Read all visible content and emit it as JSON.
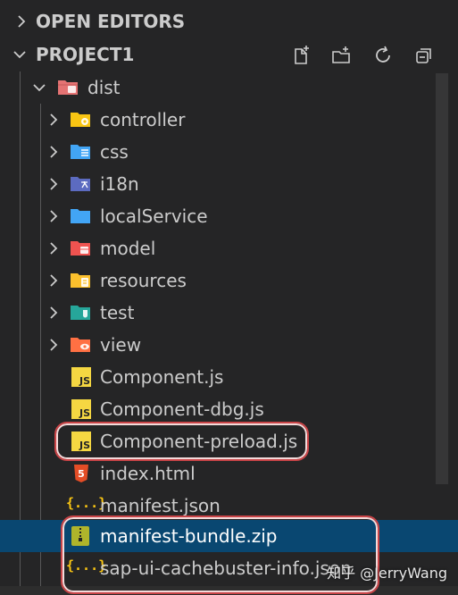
{
  "sections": {
    "open_editors": "OPEN EDITORS",
    "project": "PROJECT1"
  },
  "toolbar": {
    "new_file": "new-file-icon",
    "new_folder": "new-folder-icon",
    "refresh": "refresh-icon",
    "collapse": "collapse-all-icon"
  },
  "tree": {
    "root": "dist",
    "folders": [
      {
        "label": "controller",
        "icon": "folder-controller-icon",
        "color": "#f9c513"
      },
      {
        "label": "css",
        "icon": "folder-css-icon",
        "color": "#42a5f5"
      },
      {
        "label": "i18n",
        "icon": "folder-i18n-icon",
        "color": "#5c6bc0"
      },
      {
        "label": "localService",
        "icon": "folder-icon",
        "color": "#42a5f5"
      },
      {
        "label": "model",
        "icon": "folder-model-icon",
        "color": "#ef5350"
      },
      {
        "label": "resources",
        "icon": "folder-resources-icon",
        "color": "#fbc02d"
      },
      {
        "label": "test",
        "icon": "folder-test-icon",
        "color": "#26a69a"
      },
      {
        "label": "view",
        "icon": "folder-view-icon",
        "color": "#ff7043"
      }
    ],
    "files": [
      {
        "label": "Component.js",
        "icon": "js-file-icon"
      },
      {
        "label": "Component-dbg.js",
        "icon": "js-file-icon"
      },
      {
        "label": "Component-preload.js",
        "icon": "js-file-icon"
      },
      {
        "label": "index.html",
        "icon": "html-file-icon"
      },
      {
        "label": "manifest.json",
        "icon": "json-file-icon"
      },
      {
        "label": "manifest-bundle.zip",
        "icon": "zip-file-icon"
      },
      {
        "label": "sap-ui-cachebuster-info.json",
        "icon": "json-file-icon"
      }
    ]
  },
  "icon_text": {
    "js": "JS",
    "json": "{...}",
    "html": "5"
  },
  "watermark": "知乎 @JerryWang",
  "colors": {
    "background": "#252526",
    "selection": "#094771",
    "highlight": "#c94447",
    "js": "#f5d742"
  }
}
